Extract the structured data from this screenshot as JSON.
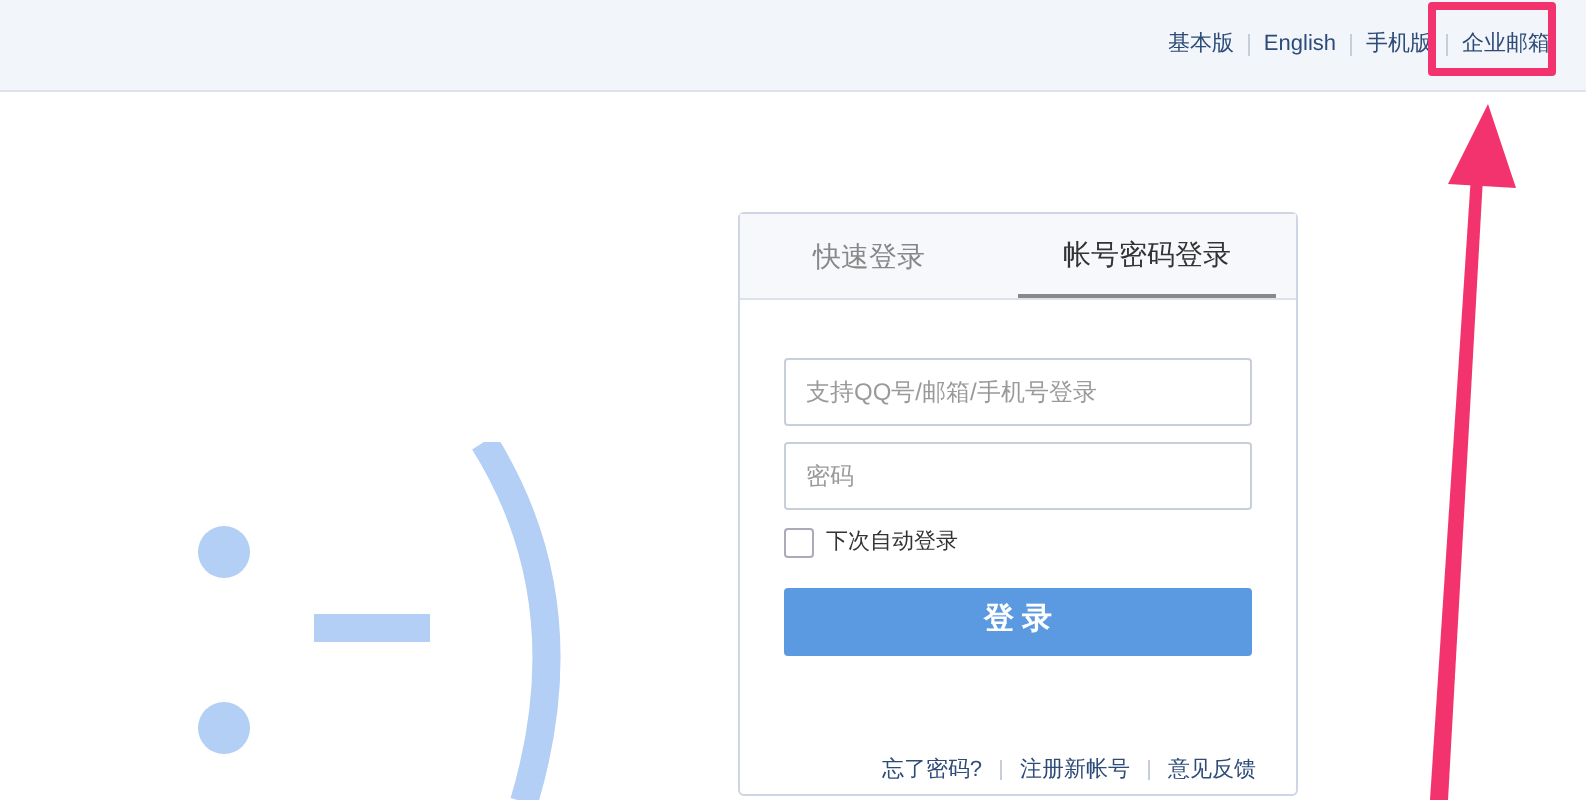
{
  "top_links": [
    "基本版",
    "English",
    "手机版",
    "企业邮箱"
  ],
  "login": {
    "tabs": [
      {
        "label": "快速登录",
        "selected": false
      },
      {
        "label": "帐号密码登录",
        "selected": true
      }
    ],
    "fields": [
      {
        "placeholder": "支持QQ号/邮箱/手机号登录"
      },
      {
        "placeholder": "密码"
      }
    ],
    "remember": {
      "label": "下次自动登录",
      "checked": false
    },
    "submit": "登 录",
    "footer_links": [
      "忘了密码?",
      "注册新帐号",
      "意见反馈"
    ]
  }
}
